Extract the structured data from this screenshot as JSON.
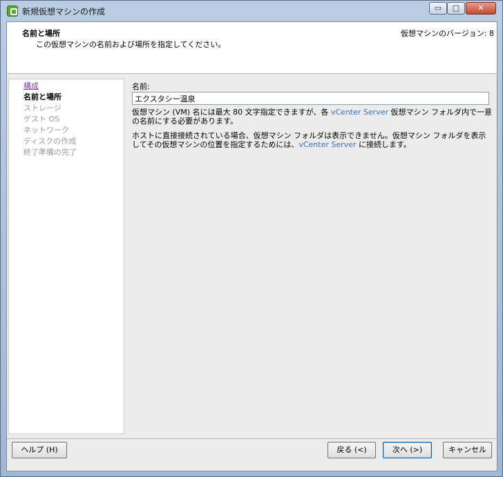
{
  "window": {
    "title": "新規仮想マシンの作成",
    "minimize": "▭",
    "maximize": "□",
    "close": "✕"
  },
  "header": {
    "title": "名前と場所",
    "subtitle": "この仮想マシンの名前および場所を指定してください。",
    "version": "仮想マシンのバージョン: 8"
  },
  "nav": {
    "items": [
      {
        "label": "構成",
        "state": "link"
      },
      {
        "label": "名前と場所",
        "state": "current"
      },
      {
        "label": "ストレージ",
        "state": "disabled"
      },
      {
        "label": "ゲスト OS",
        "state": "disabled"
      },
      {
        "label": "ネットワーク",
        "state": "disabled"
      },
      {
        "label": "ディスクの作成",
        "state": "disabled"
      },
      {
        "label": "終了準備の完了",
        "state": "disabled"
      }
    ]
  },
  "form": {
    "name_label": "名前:",
    "name_value": "エクスタシー温泉",
    "info1_a": "仮想マシン (VM) 名には最大 80 文字指定できますが、各 ",
    "info1_vc": "vCenter Server",
    "info1_b": " 仮想マシン フォルダ内で一意の名前にする必要があります。",
    "info2_a": "ホストに直接接続されている場合、仮想マシン フォルダは表示できません。仮想マシン フォルダを表示してその仮想マシンの位置を指定するためには、",
    "info2_vc": "vCenter Server",
    "info2_b": " に接続します。"
  },
  "buttons": {
    "help": "ヘルプ (H)",
    "back": "戻る (<)",
    "next": "次へ (>)",
    "cancel": "キャンセル"
  }
}
